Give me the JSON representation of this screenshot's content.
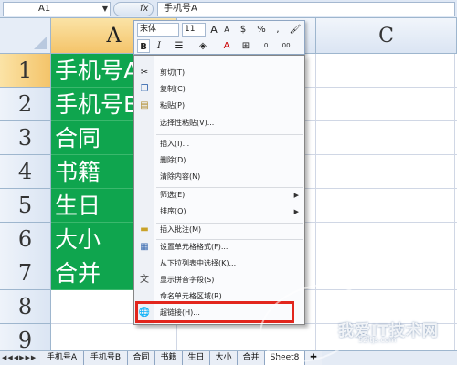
{
  "formula_bar": {
    "name_box": "A1",
    "fx": "fx",
    "content": "手机号A"
  },
  "columns": [
    "A",
    "C"
  ],
  "rows": [
    "1",
    "2",
    "3",
    "4",
    "5",
    "6",
    "7",
    "8",
    "9"
  ],
  "cells_a": [
    "手机号A",
    "手机号B",
    "合同",
    "书籍",
    "生日",
    "大小",
    "合并",
    "",
    ""
  ],
  "mini_toolbar": {
    "font": "宋体",
    "size": "11",
    "grow": "A",
    "shrink": "A",
    "currency": "$",
    "percent": "%",
    "comma": ",",
    "bold": "B",
    "italic": "I",
    "font_color": "A",
    "increase_decimal": ".0",
    "decrease_decimal": ".00"
  },
  "context_menu": {
    "items": [
      {
        "label": "剪切(T)",
        "icon": "scissors-icon"
      },
      {
        "label": "复制(C)",
        "icon": "copy-icon"
      },
      {
        "label": "粘贴(P)",
        "icon": "paste-icon"
      },
      {
        "label": "选择性粘贴(V)...",
        "icon": ""
      },
      {
        "label": "插入(I)...",
        "icon": ""
      },
      {
        "label": "删除(D)...",
        "icon": ""
      },
      {
        "label": "清除内容(N)",
        "icon": ""
      },
      {
        "label": "筛选(E)",
        "icon": "",
        "submenu": true
      },
      {
        "label": "排序(O)",
        "icon": "",
        "submenu": true
      },
      {
        "label": "插入批注(M)",
        "icon": "comment-icon"
      },
      {
        "label": "设置单元格格式(F)...",
        "icon": "format-cells-icon"
      },
      {
        "label": "从下拉列表中选择(K)...",
        "icon": ""
      },
      {
        "label": "显示拼音字段(S)",
        "icon": "phonetic-icon"
      },
      {
        "label": "命名单元格区域(R)...",
        "icon": ""
      },
      {
        "label": "超链接(H)...",
        "icon": "hyperlink-icon"
      }
    ]
  },
  "sheet_tabs": [
    "手机号A",
    "手机号B",
    "合同",
    "书籍",
    "生日",
    "大小",
    "合并",
    "Sheet8"
  ],
  "active_sheet": "Sheet8",
  "colors": {
    "cell_green": "#0fa54e",
    "highlight_red": "#e2261d",
    "header_active": "#f4c46a"
  }
}
